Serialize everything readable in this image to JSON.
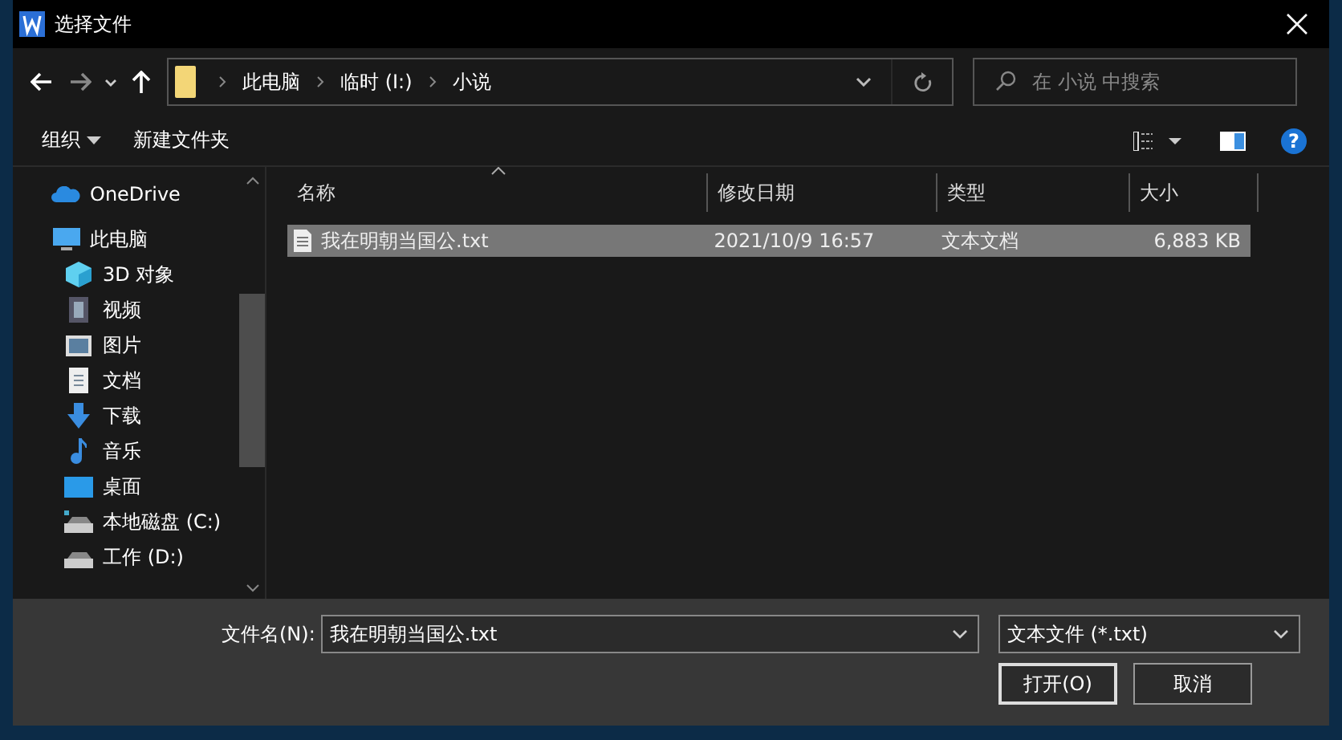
{
  "window": {
    "title": "选择文件"
  },
  "address": {
    "path": [
      "此电脑",
      "临时 (I:)",
      "小说"
    ]
  },
  "search": {
    "placeholder": "在 小说 中搜索"
  },
  "toolbar": {
    "organize": "组织",
    "new_folder": "新建文件夹",
    "help": "?"
  },
  "sidebar": {
    "items": [
      {
        "label": "OneDrive",
        "kind": "cloud"
      },
      {
        "label": "此电脑",
        "kind": "pc",
        "children": [
          {
            "label": "3D 对象",
            "kind": "cube"
          },
          {
            "label": "视频",
            "kind": "video"
          },
          {
            "label": "图片",
            "kind": "picture"
          },
          {
            "label": "文档",
            "kind": "document"
          },
          {
            "label": "下载",
            "kind": "download"
          },
          {
            "label": "音乐",
            "kind": "music"
          },
          {
            "label": "桌面",
            "kind": "desktop"
          },
          {
            "label": "本地磁盘 (C:)",
            "kind": "disk"
          },
          {
            "label": "工作 (D:)",
            "kind": "drive"
          }
        ]
      }
    ]
  },
  "table": {
    "columns": [
      "名称",
      "修改日期",
      "类型",
      "大小"
    ],
    "rows": [
      {
        "name": "我在明朝当国公.txt",
        "date": "2021/10/9 16:57",
        "type": "文本文档",
        "size": "6,883 KB",
        "selected": true
      }
    ]
  },
  "footer": {
    "filename_label": "文件名(N):",
    "filename": "我在明朝当国公.txt",
    "filter": "文本文件 (*.txt)",
    "buttons": [
      "打开(O)",
      "取消"
    ]
  }
}
